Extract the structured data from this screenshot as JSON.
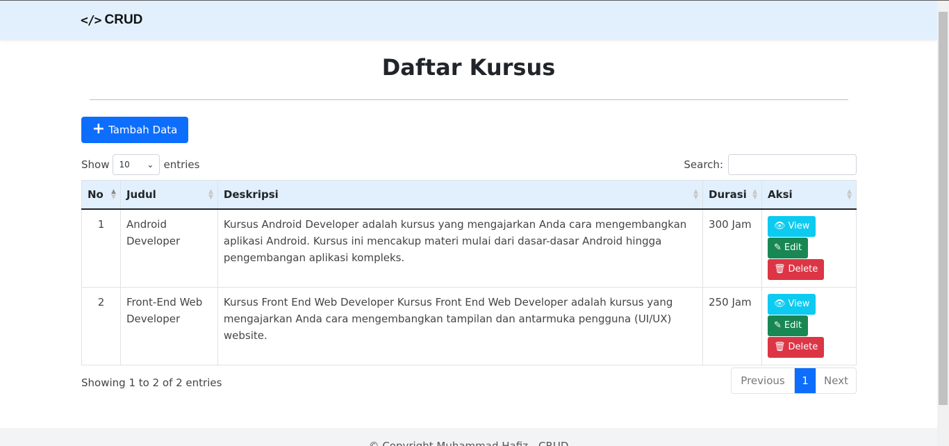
{
  "navbar": {
    "brand_icon": "</>",
    "brand_label": "CRUD"
  },
  "page": {
    "title": "Daftar Kursus"
  },
  "toolbar": {
    "add_label": "Tambah Data",
    "add_icon": "plus-icon"
  },
  "controls": {
    "show_label": "Show",
    "show_value": "10",
    "entries_label": "entries",
    "search_label": "Search:",
    "search_value": ""
  },
  "table": {
    "columns": [
      "No",
      "Judul",
      "Deskripsi",
      "Durasi",
      "Aksi"
    ],
    "rows": [
      {
        "no": "1",
        "judul": "Android Developer",
        "deskripsi": "Kursus Android Developer adalah kursus yang mengajarkan Anda cara mengembangkan aplikasi Android. Kursus ini mencakup materi mulai dari dasar-dasar Android hingga pengembangan aplikasi kompleks.",
        "durasi": "300 Jam"
      },
      {
        "no": "2",
        "judul": "Front-End Web Developer",
        "deskripsi": "Kursus Front End Web Developer Kursus Front End Web Developer adalah kursus yang mengajarkan Anda cara mengembangkan tampilan dan antarmuka pengguna (UI/UX) website.",
        "durasi": "250 Jam"
      }
    ],
    "actions": {
      "view": "View",
      "edit": "Edit",
      "delete": "Delete"
    }
  },
  "pagination": {
    "info": "Showing 1 to 2 of 2 entries",
    "previous": "Previous",
    "current": "1",
    "next": "Next"
  },
  "footer": {
    "text": "© Copyright Muhammad Hafiz - CRUD"
  },
  "colors": {
    "primary": "#0d6efd",
    "info": "#0dcaf0",
    "success": "#198754",
    "danger": "#dc3545",
    "navbar_bg": "#e1f0fc"
  }
}
